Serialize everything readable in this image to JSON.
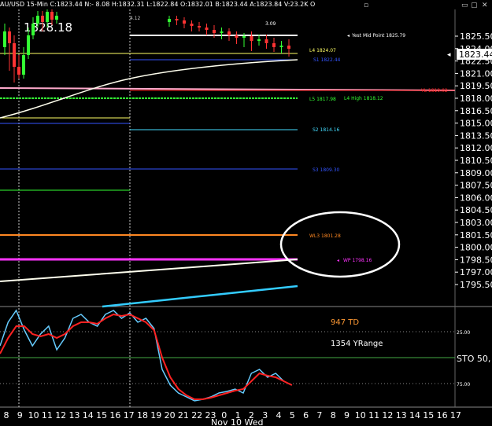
{
  "header": {
    "info": "AU/USD 15-Min C:1823.44 N:- 8.08 H:1832.31 L:1822.84 O:1832.01 B:1823.44 A:1823.84 V:23.2K O",
    "big_price": "1828.18",
    "close_icon": "close-icon",
    "minimize_icon": "minimize-icon"
  },
  "price_axis": {
    "current_price": "1823.44",
    "ticks": [
      "1825.50",
      "1824.00",
      "1822.50",
      "1821.00",
      "1819.50",
      "1818.00",
      "1816.50",
      "1815.00",
      "1813.50",
      "1812.00",
      "1810.50",
      "1809.00",
      "1807.50",
      "1806.00",
      "1804.50",
      "1803.00",
      "1801.50",
      "1800.00",
      "1798.50",
      "1797.00",
      "1795.50"
    ],
    "colors": {
      "current_price_bg": "#ffffff",
      "text": "#ffffff"
    }
  },
  "levels": [
    {
      "label": "Yest Mid Point 1825.79",
      "color": "#ffffff"
    },
    {
      "label": "L4 1824.07",
      "color": "#ffff66"
    },
    {
      "label": "S1 1822.44",
      "color": "#3355ff"
    },
    {
      "label": "YL 1819.02",
      "color": "#ff2222"
    },
    {
      "label": "L5 1817.98",
      "color": "#33ff33"
    },
    {
      "label": "L4 High 1818.12",
      "color": "#33ff33"
    },
    {
      "label": "S2 1814.16",
      "color": "#44ddff"
    },
    {
      "label": "S3 1809.30",
      "color": "#3355ff"
    },
    {
      "label": "WL3 1801.28",
      "color": "#ff8822"
    },
    {
      "label": "WP 1798.16",
      "color": "#ff33ff"
    }
  ],
  "chart_labels": {
    "top_tag": "3.09",
    "left_tag": "4.12"
  },
  "stats": {
    "td": "947 TD",
    "yrange": "1354 YRange",
    "td_color": "#ff9933"
  },
  "oscillator": {
    "label": "STO  50,",
    "levels": [
      "25.00",
      "75.00"
    ]
  },
  "time_axis": {
    "ticks": [
      "8",
      "9",
      "10",
      "11",
      "12",
      "13",
      "14",
      "15",
      "16",
      "17",
      "18",
      "19",
      "20",
      "21",
      "22",
      "23",
      "0",
      "1",
      "2",
      "3",
      "4",
      "5",
      "6",
      "7",
      "8",
      "9",
      "10",
      "11",
      "12",
      "13",
      "14",
      "15",
      "16",
      "17"
    ],
    "date_label": "Nov 10 Wed"
  }
}
